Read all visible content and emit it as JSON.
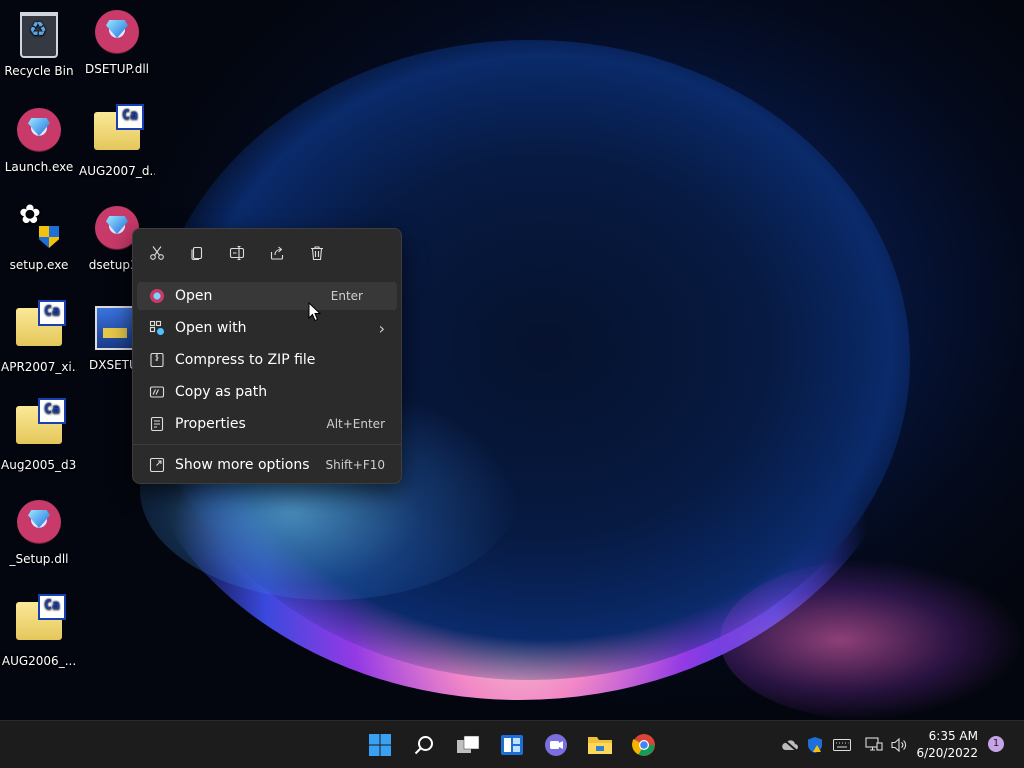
{
  "desktop": {
    "icons": [
      {
        "label": "Recycle Bin"
      },
      {
        "label": "DSETUP.dll"
      },
      {
        "label": "Launch.exe"
      },
      {
        "label": "AUG2007_d..."
      },
      {
        "label": "setup.exe"
      },
      {
        "label": "dsetup32"
      },
      {
        "label": "APR2007_xi..."
      },
      {
        "label": "DXSETUP"
      },
      {
        "label": "Aug2005_d3..."
      },
      {
        "label": "_Setup.dll"
      },
      {
        "label": "AUG2006_..."
      }
    ]
  },
  "context_menu": {
    "quick_actions": [
      "cut",
      "copy",
      "rename",
      "share",
      "delete"
    ],
    "items": [
      {
        "label": "Open",
        "shortcut": "Enter",
        "icon": "app-gem-icon",
        "highlighted": true
      },
      {
        "label": "Open with",
        "submenu": true,
        "icon": "open-with-icon"
      },
      {
        "label": "Compress to ZIP file",
        "icon": "zip-icon"
      },
      {
        "label": "Copy as path",
        "icon": "copy-path-icon"
      },
      {
        "label": "Properties",
        "shortcut": "Alt+Enter",
        "icon": "properties-icon"
      },
      {
        "label": "Show more options",
        "shortcut": "Shift+F10",
        "icon": "more-options-icon"
      }
    ]
  },
  "taskbar": {
    "apps": [
      "start",
      "search",
      "task-view",
      "widgets",
      "teams-chat",
      "file-explorer",
      "chrome"
    ],
    "clock": {
      "time": "6:35 AM",
      "date": "6/20/2022"
    },
    "notification_count": "1"
  },
  "colors": {
    "menu_bg": "#2b2b2b",
    "taskbar_bg": "#1c1c1c",
    "accent": "#4cc2ff"
  }
}
